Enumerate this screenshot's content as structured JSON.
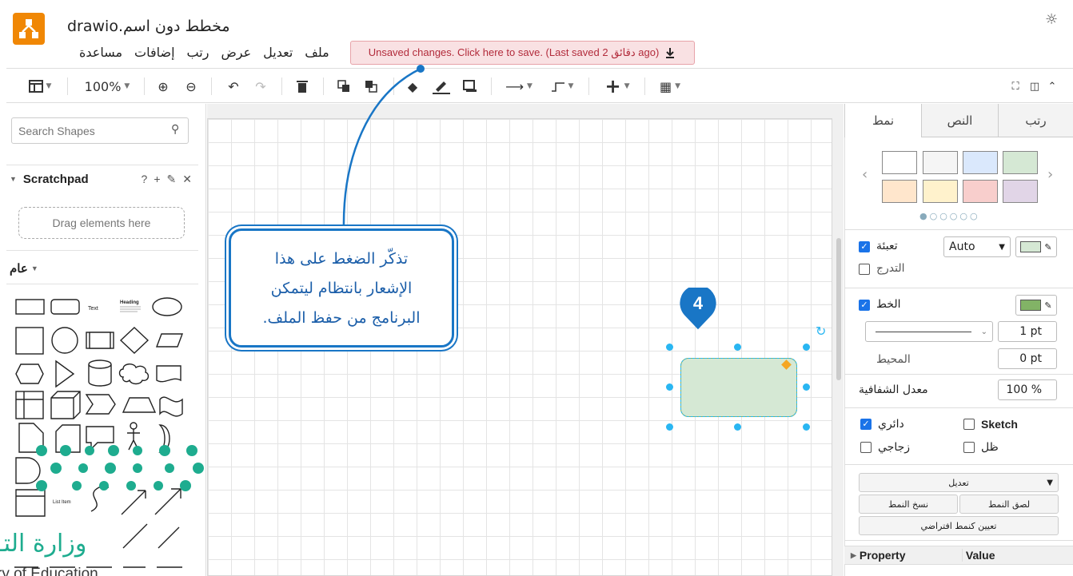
{
  "header": {
    "title": "مخطط دون اسم.drawio",
    "menu": [
      "ملف",
      "تعديل",
      "عرض",
      "رتب",
      "إضافات",
      "مساعدة"
    ],
    "save_notice": "Unsaved changes. Click here to save. (Last saved 2 دقائق ago)"
  },
  "toolbar": {
    "zoom": "100%"
  },
  "sidebar": {
    "search_placeholder": "Search Shapes",
    "scratchpad_title": "Scratchpad",
    "scratchpad_help": "?",
    "scratchpad_drop": "Drag elements here",
    "general_title": "عام",
    "shape_text_label": "Text",
    "shape_heading_label": "Heading",
    "shape_list_label": "List Item"
  },
  "format_panel": {
    "tabs": [
      "رتب",
      "النص",
      "نمط"
    ],
    "active_tab": "نمط",
    "swatches": [
      "#ffffff",
      "#f5f5f5",
      "#dae8fc",
      "#d5e8d4",
      "#ffe6cc",
      "#fff2cc",
      "#f8cecc",
      "#e1d5e7"
    ],
    "fill_label": "تعبئة",
    "fill_mode": "Auto",
    "fill_color": "#d5e8d4",
    "gradient_label": "التدرج",
    "line_label": "الخط",
    "line_color": "#82b366",
    "line_width": "1 pt",
    "perimeter_label": "المحيط",
    "perimeter_value": "0 pt",
    "opacity_label": "معدل الشفافية",
    "opacity_value": "100 %",
    "rounded_label": "دائري",
    "sketch_label": "Sketch",
    "glass_label": "زجاجي",
    "shadow_label": "ظل",
    "edit_select": "تعديل",
    "paste_style": "لصق النمط",
    "copy_style": "نسخ النمط",
    "set_default": "تعيين كنمط افتراضي",
    "property_header": "Property",
    "value_header": "Value"
  },
  "callout": {
    "lines": [
      "تذكّر الضغط على هذا",
      "الإشعار بانتظام ليتمكن",
      "البرنامج من حفظ الملف."
    ],
    "badge": "4"
  },
  "watermark": {
    "arabic": "وزارة التـ",
    "english": "ry of Education"
  }
}
